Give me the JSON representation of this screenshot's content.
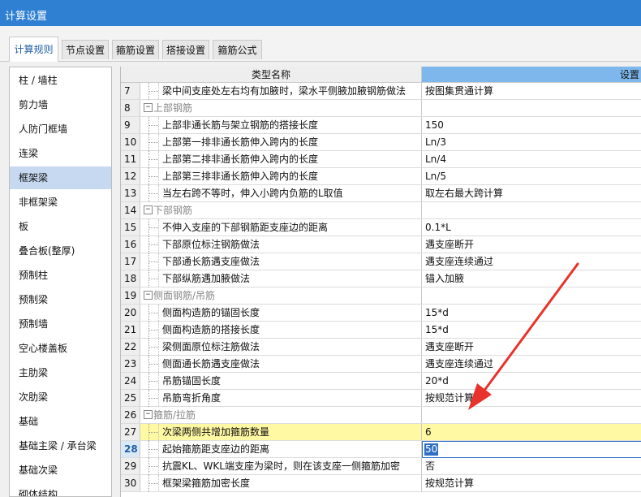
{
  "window": {
    "title": "计算设置"
  },
  "tabs": [
    {
      "label": "计算规则",
      "active": true
    },
    {
      "label": "节点设置"
    },
    {
      "label": "箍筋设置"
    },
    {
      "label": "搭接设置"
    },
    {
      "label": "箍筋公式"
    }
  ],
  "sidebar": {
    "items": [
      {
        "label": "柱 / 墙柱"
      },
      {
        "label": "剪力墙"
      },
      {
        "label": "人防门框墙"
      },
      {
        "label": "连梁"
      },
      {
        "label": "框架梁",
        "selected": true
      },
      {
        "label": "非框架梁"
      },
      {
        "label": "板"
      },
      {
        "label": "叠合板(整厚)"
      },
      {
        "label": "预制柱"
      },
      {
        "label": "预制梁"
      },
      {
        "label": "预制墙"
      },
      {
        "label": "空心楼盖板"
      },
      {
        "label": "主肋梁"
      },
      {
        "label": "次肋梁"
      },
      {
        "label": "基础"
      },
      {
        "label": "基础主梁 / 承台梁"
      },
      {
        "label": "基础次梁"
      },
      {
        "label": "砌体结构"
      }
    ]
  },
  "grid": {
    "header_name": "类型名称",
    "header_value": "设置",
    "rows": [
      {
        "num": "7",
        "name": "梁中间支座处左右均有加腋时，梁水平侧腋加腋钢筋做法",
        "value": "按图集贯通计算"
      },
      {
        "num": "8",
        "group": true,
        "name": "上部钢筋",
        "toggle": "−"
      },
      {
        "num": "9",
        "name": "上部非通长筋与架立钢筋的搭接长度",
        "value": "150"
      },
      {
        "num": "10",
        "name": "上部第一排非通长筋伸入跨内的长度",
        "value": "Ln/3"
      },
      {
        "num": "11",
        "name": "上部第二排非通长筋伸入跨内的长度",
        "value": "Ln/4"
      },
      {
        "num": "12",
        "name": "上部第三排非通长筋伸入跨内的长度",
        "value": "Ln/5"
      },
      {
        "num": "13",
        "name": "当左右跨不等时，伸入小跨内负筋的L取值",
        "value": "取左右最大跨计算"
      },
      {
        "num": "14",
        "group": true,
        "name": "下部钢筋",
        "toggle": "−"
      },
      {
        "num": "15",
        "name": "不伸入支座的下部钢筋距支座边的距离",
        "value": "0.1*L"
      },
      {
        "num": "16",
        "name": "下部原位标注钢筋做法",
        "value": "遇支座断开"
      },
      {
        "num": "17",
        "name": "下部通长筋遇支座做法",
        "value": "遇支座连续通过"
      },
      {
        "num": "18",
        "name": "下部纵筋遇加腋做法",
        "value": "锚入加腋"
      },
      {
        "num": "19",
        "group": true,
        "name": "侧面钢筋/吊筋",
        "toggle": "−"
      },
      {
        "num": "20",
        "name": "侧面构造筋的锚固长度",
        "value": "15*d"
      },
      {
        "num": "21",
        "name": "侧面构造筋的搭接长度",
        "value": "15*d"
      },
      {
        "num": "22",
        "name": "梁侧面原位标注筋做法",
        "value": "遇支座断开"
      },
      {
        "num": "23",
        "name": "侧面通长筋遇支座做法",
        "value": "遇支座连续通过"
      },
      {
        "num": "24",
        "name": "吊筋锚固长度",
        "value": "20*d"
      },
      {
        "num": "25",
        "name": "吊筋弯折角度",
        "value": "按规范计算"
      },
      {
        "num": "26",
        "group": true,
        "name": "箍筋/拉筋",
        "toggle": "−"
      },
      {
        "num": "27",
        "name": "次梁两侧共增加箍筋数量",
        "value": "6",
        "highlight": true
      },
      {
        "num": "28",
        "name": "起始箍筋距支座边的距离",
        "value": "50",
        "editing": true
      },
      {
        "num": "29",
        "name": "抗震KL、WKL端支座为梁时，则在该支座一侧箍筋加密",
        "value": "否"
      },
      {
        "num": "30",
        "name": "框架梁箍筋加密长度",
        "value": "按规范计算"
      }
    ]
  },
  "colors": {
    "titlebar": "#2f7fd3",
    "header_value": "#7db7ec",
    "highlight_row": "#fff9a3",
    "arrow": "#e8322b",
    "selected_item": "#c6d9f0"
  }
}
